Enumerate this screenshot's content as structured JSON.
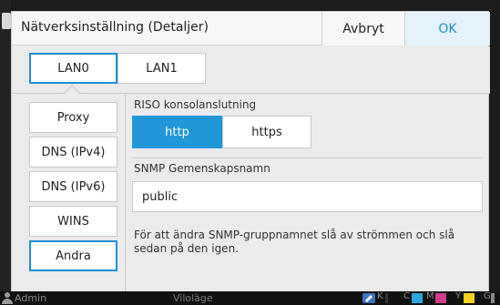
{
  "dialog": {
    "title": "Nätverksinställning (Detaljer)",
    "cancel_label": "Avbryt",
    "ok_label": "OK"
  },
  "lan_tabs": [
    {
      "label": "LAN0",
      "active": true
    },
    {
      "label": "LAN1",
      "active": false
    }
  ],
  "side_menu": [
    {
      "label": "Proxy",
      "active": false
    },
    {
      "label": "DNS (IPv4)",
      "active": false
    },
    {
      "label": "DNS (IPv6)",
      "active": false
    },
    {
      "label": "WINS",
      "active": false
    },
    {
      "label": "Andra",
      "active": true
    }
  ],
  "console": {
    "label": "RISO konsolanslutning",
    "options": [
      "http",
      "https"
    ],
    "selected": "http"
  },
  "snmp": {
    "label": "SNMP Gemenskapsnamn",
    "value": "public",
    "note": "För att ändra SNMP-gruppnamnet slå av strömmen och slå sedan på den igen."
  },
  "status_bar": {
    "user": "Admin",
    "mode": "Viloläge",
    "ink_labels": [
      "K",
      "C",
      "M",
      "Y",
      "G"
    ]
  },
  "colors": {
    "accent": "#2196d9",
    "cyan": "#2aa6e0",
    "magenta": "#d23a8c",
    "yellow": "#f2d21b"
  }
}
